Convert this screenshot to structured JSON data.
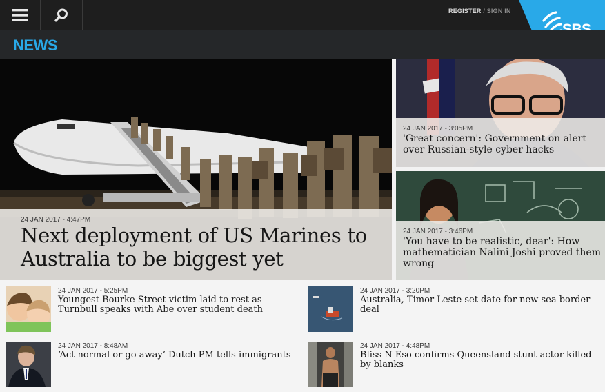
{
  "header": {
    "register_label": "REGISTER",
    "separator": "/",
    "signin_label": "SIGN IN",
    "logo_text": "SBS",
    "brand_color": "#29a9e8",
    "menu_icon": "hamburger-menu-icon",
    "search_icon": "magnifier-search-icon"
  },
  "section": {
    "title": "NEWS"
  },
  "hero": {
    "timestamp": "24 JAN 2017 - 4:47PM",
    "headline": "Next deployment of US Marines to Australia to be biggest yet"
  },
  "side_stories": [
    {
      "timestamp": "24 JAN 2017 - 3:05PM",
      "headline": "'Great concern': Government on alert over Russian-style cyber hacks"
    },
    {
      "timestamp": "24 JAN 2017 - 3:46PM",
      "headline": "'You have to be realistic, dear': How mathematician Nalini Joshi proved them wrong"
    }
  ],
  "stories": [
    {
      "timestamp": "24 JAN 2017 - 5:25PM",
      "headline": "Youngest Bourke Street victim laid to rest as Turnbull speaks with Abe over student death"
    },
    {
      "timestamp": "24 JAN 2017 - 3:20PM",
      "headline": "Australia, Timor Leste set date for new sea border deal"
    },
    {
      "timestamp": "24 JAN 2017 - 8:48AM",
      "headline": "‘Act normal or go away’ Dutch PM tells immigrants"
    },
    {
      "timestamp": "24 JAN 2017 - 4:48PM",
      "headline": "Bliss N Eso confirms Queensland stunt actor killed by blanks"
    }
  ]
}
